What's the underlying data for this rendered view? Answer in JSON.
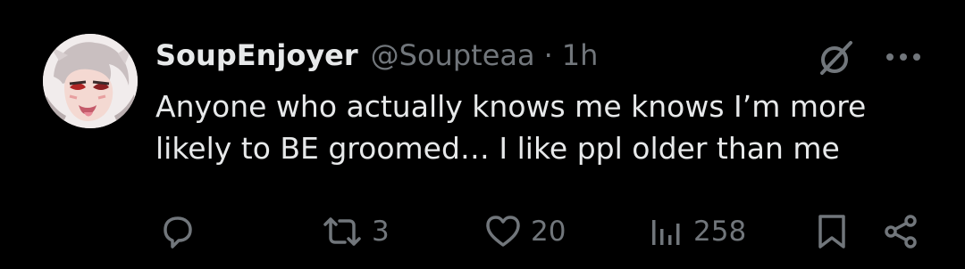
{
  "tweet": {
    "author_name": "SoupEnjoyer",
    "handle": "@Soupteaa",
    "separator": "·",
    "time": "1h",
    "text": "Anyone who actually knows me knows I’m more likely to BE groomed… I like ppl older than me",
    "avatar_icon": "anime-avatar-image",
    "actions": {
      "reply_icon": "reply-icon",
      "retweet_count": "3",
      "like_count": "20",
      "view_count": "258"
    }
  },
  "colors": {
    "background": "#000000",
    "text_primary": "#e7e9ea",
    "text_secondary": "#71767b"
  }
}
